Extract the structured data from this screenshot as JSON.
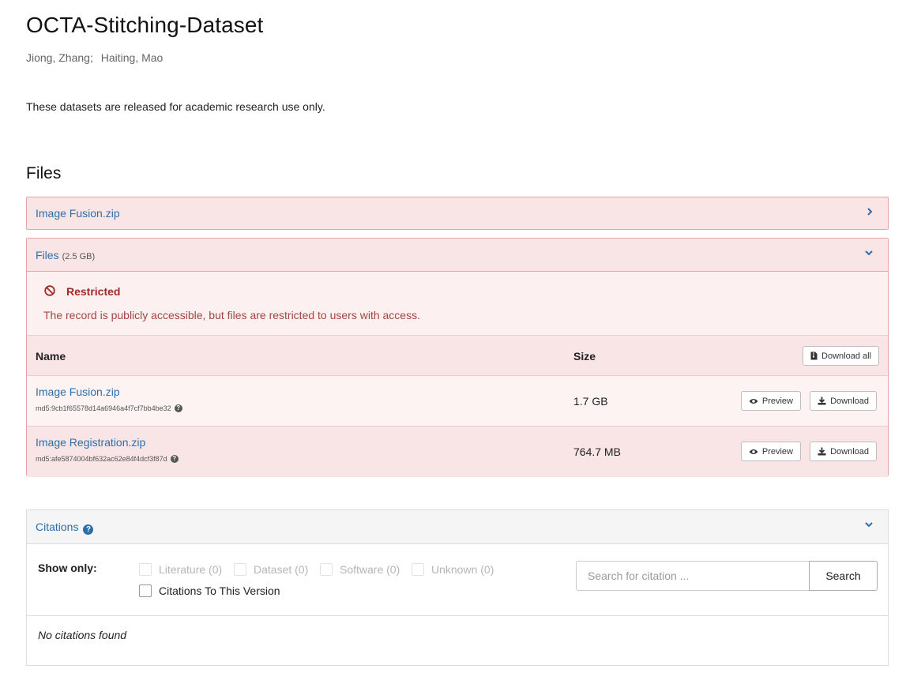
{
  "title": "OCTA-Stitching-Dataset",
  "authors": [
    "Jiong, Zhang;",
    "Haiting, Mao"
  ],
  "description": "These datasets are released for academic research use only.",
  "files_heading": "Files",
  "collapsed_panel": {
    "label": "Image Fusion.zip"
  },
  "files_panel": {
    "label": "Files",
    "size_note": "(2.5 GB)",
    "restricted": {
      "title": "Restricted",
      "message": "The record is publicly accessible, but files are restricted to users with access."
    },
    "table": {
      "col_name": "Name",
      "col_size": "Size",
      "download_all": "Download all",
      "rows": [
        {
          "name": "Image Fusion.zip",
          "md5": "md5:9cb1f65578d14a6946a4f7cf7bb4be32",
          "size": "1.7 GB",
          "preview": "Preview",
          "download": "Download"
        },
        {
          "name": "Image Registration.zip",
          "md5": "md5:afe5874004bf632ac62e84f4dcf3f87d",
          "size": "764.7 MB",
          "preview": "Preview",
          "download": "Download"
        }
      ]
    }
  },
  "citations": {
    "label": "Citations",
    "show_only": "Show only:",
    "filters": [
      "Literature (0)",
      "Dataset (0)",
      "Software (0)",
      "Unknown (0)"
    ],
    "version_filter": "Citations To This Version",
    "search_placeholder": "Search for citation ...",
    "search_button": "Search",
    "empty": "No citations found"
  },
  "colors": {
    "link": "#2d6ea8",
    "restricted_title": "#9e2a2a",
    "panel_bg": "#f9e5e5",
    "panel_border": "#e4a6a6"
  }
}
